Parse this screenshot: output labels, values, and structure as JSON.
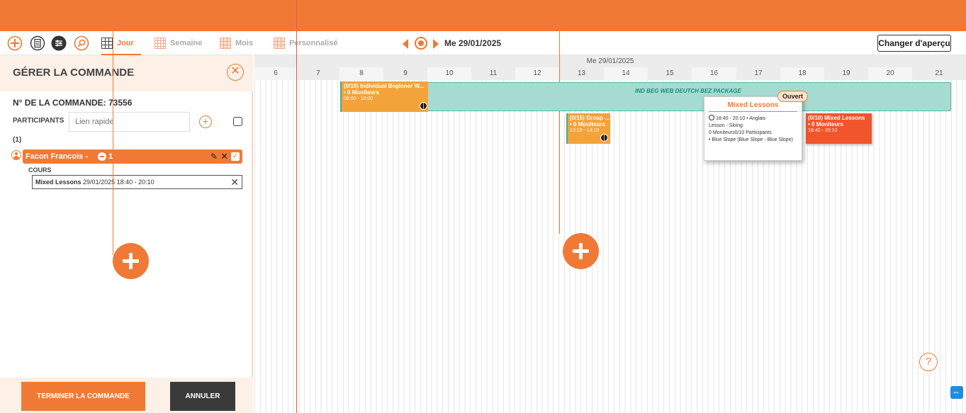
{
  "toolbar": {
    "views": [
      "Jour",
      "Semaine",
      "Mois",
      "Personnalisé"
    ],
    "active_view": "Jour",
    "current_date": "Me 29/01/2025",
    "change_view_label": "Changer d'aperçu"
  },
  "order_panel": {
    "title": "GÉRER LA COMMANDE",
    "order_number_label": "N° DE LA COMMANDE: 73556",
    "participants_label": "PARTICIPANTS",
    "quick_link_placeholder": "Lien rapide",
    "participant_count": "(1)",
    "participant": {
      "name": "Facon Francois -",
      "count": "1"
    },
    "courses_label": "COURS",
    "course": {
      "name": "Mixed Lessons",
      "schedule": "29/01/2025 18:40 - 20:10"
    },
    "finish_label": "TERMINER LA COMMANDE",
    "cancel_label": "ANNULER"
  },
  "calendar": {
    "date_header": "Me 29/01/2025",
    "hours": [
      "6",
      "7",
      "8",
      "9",
      "10",
      "11",
      "12",
      "13",
      "14",
      "15",
      "16",
      "17",
      "18",
      "19",
      "20",
      "21"
    ],
    "package_label": "IND BEG WEB DEUTCH BEZ PACKAGE",
    "events": [
      {
        "title": "(0/10) Individual Beginner W...",
        "subtitle": "• 0 Moniteurs",
        "time": "08:00 - 10:00"
      },
      {
        "title": "(0/15) Group ...",
        "subtitle": "• 0 Moniteurs",
        "time": "13:10 - 14:10"
      },
      {
        "title": "(0/10) Mixed Lessons",
        "subtitle": "• 0 Moniteurs",
        "time": "18:40 - 20:10"
      }
    ],
    "tooltip": {
      "title": "Mixed Lessons",
      "badge": "Ouvert",
      "lines": [
        "18:40 - 20:10 • Anglais",
        "Lesson - Skiing",
        "0 Moniteurs0/10 Participants",
        "• Blue Slope (Blue Slope - Blue Slope)"
      ]
    }
  },
  "help_label": "?",
  "colors": {
    "brand": "#f07a35",
    "package": "#a6dbd2",
    "event_orange": "#f3a33a",
    "event_red": "#f0552b"
  }
}
